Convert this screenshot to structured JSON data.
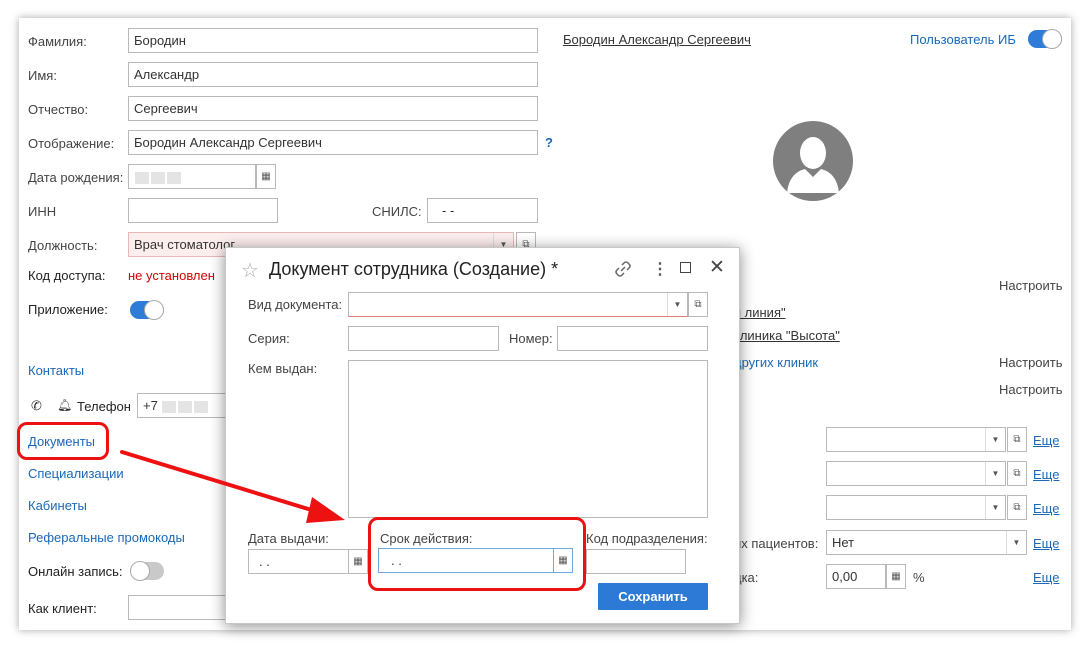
{
  "form": {
    "surname_label": "Фамилия:",
    "surname_value": "Бородин",
    "name_label": "Имя:",
    "name_value": "Александр",
    "patronymic_label": "Отчество:",
    "patronymic_value": "Сергеевич",
    "display_label": "Отображение:",
    "display_value": "Бородин Александр Сергеевич",
    "display_help": "?",
    "birthdate_label": "Дата рождения:",
    "inn_label": "ИНН",
    "snils_label": "СНИЛС:",
    "snils_value": "-    -",
    "position_label": "Должность:",
    "position_value": "Врач стоматолог",
    "access_label": "Код доступа:",
    "access_value": "не установлен",
    "app_label": "Приложение:",
    "online_label": "Онлайн запись:",
    "client_label": "Как клиент:"
  },
  "header": {
    "full_name_link": "Бородин Александр Сергеевич",
    "ib_user_label": "Пользователь ИБ"
  },
  "left_links": {
    "contacts": "Контакты",
    "phone_label": "Телефон",
    "phone_value": "+7",
    "documents": "Документы",
    "specializations": "Специализации",
    "cabinets": "Кабинеты",
    "referral": "Реферальные промокоды"
  },
  "right": {
    "setup1": "Настроить",
    "link1": "я линия\"",
    "link2": "клиника \"Высота\"",
    "link3": "других клиник",
    "setup2": "Настроить",
    "setup3": "Настроить",
    "more": "Еще",
    "patients_label": "их пациентов:",
    "patients_value": "Нет",
    "discount_label": "дка:",
    "discount_value": "0,00",
    "percent": "%"
  },
  "modal": {
    "title": "Документ сотрудника (Создание) *",
    "doc_type_label": "Вид документа:",
    "series_label": "Серия:",
    "number_label": "Номер:",
    "issued_by_label": "Кем выдан:",
    "issue_date_label": "Дата выдачи:",
    "issue_date_value": ". .",
    "expiry_label": "Срок действия:",
    "expiry_value": ". .",
    "dept_code_label": "Код подразделения:",
    "save_button": "Сохранить"
  },
  "colors": {
    "accent": "#2c7ad6",
    "link": "#1a68b7",
    "annotation_red": "#ee1111",
    "error_text": "#d40000"
  }
}
